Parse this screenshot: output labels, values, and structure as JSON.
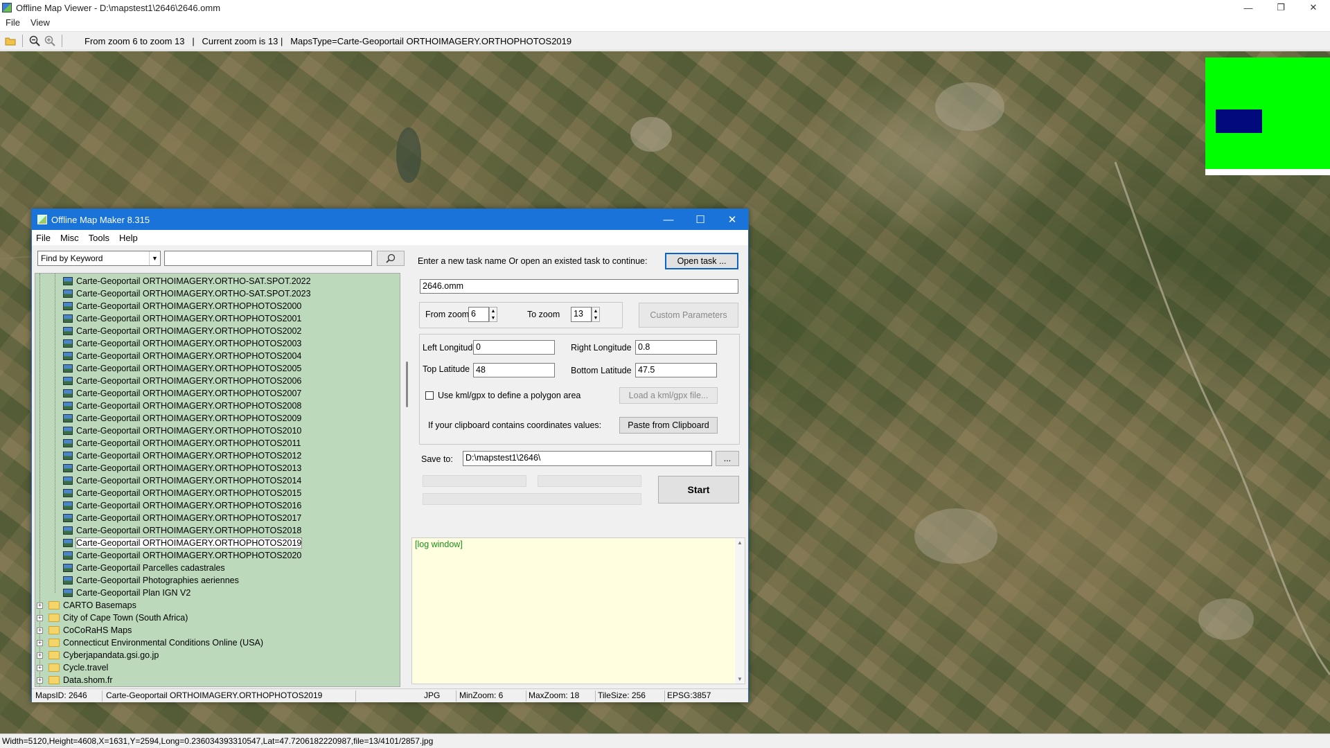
{
  "viewer": {
    "title": "Offline Map Viewer - D:\\mapstest1\\2646\\2646.omm",
    "menu": [
      "File",
      "View"
    ],
    "toolbar_text": "From zoom 6 to zoom 13   |   Current zoom is 13 |   MapsType=Carte-Geoportail ORTHOIMAGERY.ORTHOPHOTOS2019",
    "status": "Width=5120,Height=4608,X=1631,Y=2594,Long=0.236034393310547,Lat=47.7206182220987,file=13/4101/2857.jpg",
    "icons": [
      "open-folder-icon",
      "zoom-out-icon",
      "zoom-in-icon"
    ],
    "minimap_colors": {
      "background": "#00ff00",
      "viewport": "#000a7a"
    }
  },
  "dialog": {
    "title": "Offline Map Maker 8.315",
    "menu": [
      "File",
      "Misc",
      "Tools",
      "Help"
    ],
    "find_mode": "Find by Keyword",
    "search_value": "",
    "tree": {
      "leaves": [
        "Carte-Geoportail ORTHOIMAGERY.ORTHO-SAT.SPOT.2022",
        "Carte-Geoportail ORTHOIMAGERY.ORTHO-SAT.SPOT.2023",
        "Carte-Geoportail ORTHOIMAGERY.ORTHOPHOTOS2000",
        "Carte-Geoportail ORTHOIMAGERY.ORTHOPHOTOS2001",
        "Carte-Geoportail ORTHOIMAGERY.ORTHOPHOTOS2002",
        "Carte-Geoportail ORTHOIMAGERY.ORTHOPHOTOS2003",
        "Carte-Geoportail ORTHOIMAGERY.ORTHOPHOTOS2004",
        "Carte-Geoportail ORTHOIMAGERY.ORTHOPHOTOS2005",
        "Carte-Geoportail ORTHOIMAGERY.ORTHOPHOTOS2006",
        "Carte-Geoportail ORTHOIMAGERY.ORTHOPHOTOS2007",
        "Carte-Geoportail ORTHOIMAGERY.ORTHOPHOTOS2008",
        "Carte-Geoportail ORTHOIMAGERY.ORTHOPHOTOS2009",
        "Carte-Geoportail ORTHOIMAGERY.ORTHOPHOTOS2010",
        "Carte-Geoportail ORTHOIMAGERY.ORTHOPHOTOS2011",
        "Carte-Geoportail ORTHOIMAGERY.ORTHOPHOTOS2012",
        "Carte-Geoportail ORTHOIMAGERY.ORTHOPHOTOS2013",
        "Carte-Geoportail ORTHOIMAGERY.ORTHOPHOTOS2014",
        "Carte-Geoportail ORTHOIMAGERY.ORTHOPHOTOS2015",
        "Carte-Geoportail ORTHOIMAGERY.ORTHOPHOTOS2016",
        "Carte-Geoportail ORTHOIMAGERY.ORTHOPHOTOS2017",
        "Carte-Geoportail ORTHOIMAGERY.ORTHOPHOTOS2018",
        "Carte-Geoportail ORTHOIMAGERY.ORTHOPHOTOS2019",
        "Carte-Geoportail ORTHOIMAGERY.ORTHOPHOTOS2020",
        "Carte-Geoportail Parcelles cadastrales",
        "Carte-Geoportail Photographies aeriennes",
        "Carte-Geoportail Plan IGN V2"
      ],
      "selected_leaf": "Carte-Geoportail ORTHOIMAGERY.ORTHOPHOTOS2019",
      "folders": [
        "CARTO Basemaps",
        "City of Cape Town (South Africa)",
        "CoCoRaHS Maps",
        "Connecticut Environmental Conditions Online (USA)",
        "Cyberjapandata.gsi.go.jp",
        "Cycle.travel",
        "Data.shom.fr"
      ]
    },
    "task_prompt": "Enter a new task name Or open an existed task to continue:",
    "open_task_button": "Open task ...",
    "task_name": "2646.omm",
    "from_zoom_label": "From zoom",
    "from_zoom": "6",
    "to_zoom_label": "To zoom",
    "to_zoom": "13",
    "custom_params_button": "Custom Parameters",
    "left_lon_label": "Left Longitude",
    "left_lon": "0",
    "right_lon_label": "Right Longitude",
    "right_lon": "0.8",
    "top_lat_label": "Top Latitude",
    "top_lat": "48",
    "bottom_lat_label": "Bottom Latitude",
    "bottom_lat": "47.5",
    "kml_checkbox_label": "Use kml/gpx to define a polygon area",
    "load_kml_button": "Load a kml/gpx file...",
    "clipboard_label": "If your clipboard contains coordinates values:",
    "paste_button": "Paste from Clipboard",
    "save_to_label": "Save to:",
    "save_to": "D:\\mapstest1\\2646\\",
    "browse_button": "...",
    "start_button": "Start",
    "log_text": "[log window]",
    "status": {
      "maps_id": "MapsID: 2646",
      "maps_name": "Carte-Geoportail ORTHOIMAGERY.ORTHOPHOTOS2019",
      "format": "JPG",
      "min_zoom": "MinZoom: 6",
      "max_zoom": "MaxZoom: 18",
      "tile_size": "TileSize: 256",
      "epsg": "EPSG:3857"
    }
  }
}
